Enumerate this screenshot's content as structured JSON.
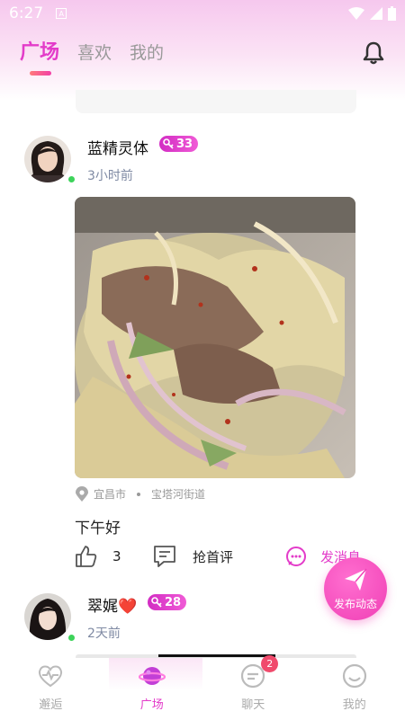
{
  "status_bar": {
    "time": "6:27",
    "notification_glyph": "A"
  },
  "header": {
    "tabs": [
      {
        "label": "广场",
        "active": true
      },
      {
        "label": "喜欢",
        "active": false
      },
      {
        "label": "我的",
        "active": false
      }
    ],
    "bell_icon": "bell-icon"
  },
  "posts": [
    {
      "username": "蓝精灵体",
      "level": "33",
      "time": "3小时前",
      "location_city": "宜昌市",
      "location_street": "宝塔河街道",
      "caption": "下午好",
      "likes": "3",
      "comment_label": "抢首评",
      "message_label": "发消息",
      "online": true
    },
    {
      "username": "翠娓❤️",
      "level": "28",
      "time": "2天前",
      "online": true
    }
  ],
  "fab": {
    "label": "发布动态"
  },
  "tabbar": {
    "items": [
      {
        "label": "邂逅",
        "icon": "heartbeat-icon"
      },
      {
        "label": "广场",
        "icon": "planet-icon"
      },
      {
        "label": "聊天",
        "icon": "chat-icon",
        "badge": "2"
      },
      {
        "label": "我的",
        "icon": "profile-icon"
      }
    ]
  },
  "colors": {
    "accent": "#e33bc9",
    "online": "#3dd35a",
    "badge": "#f04a6c"
  }
}
